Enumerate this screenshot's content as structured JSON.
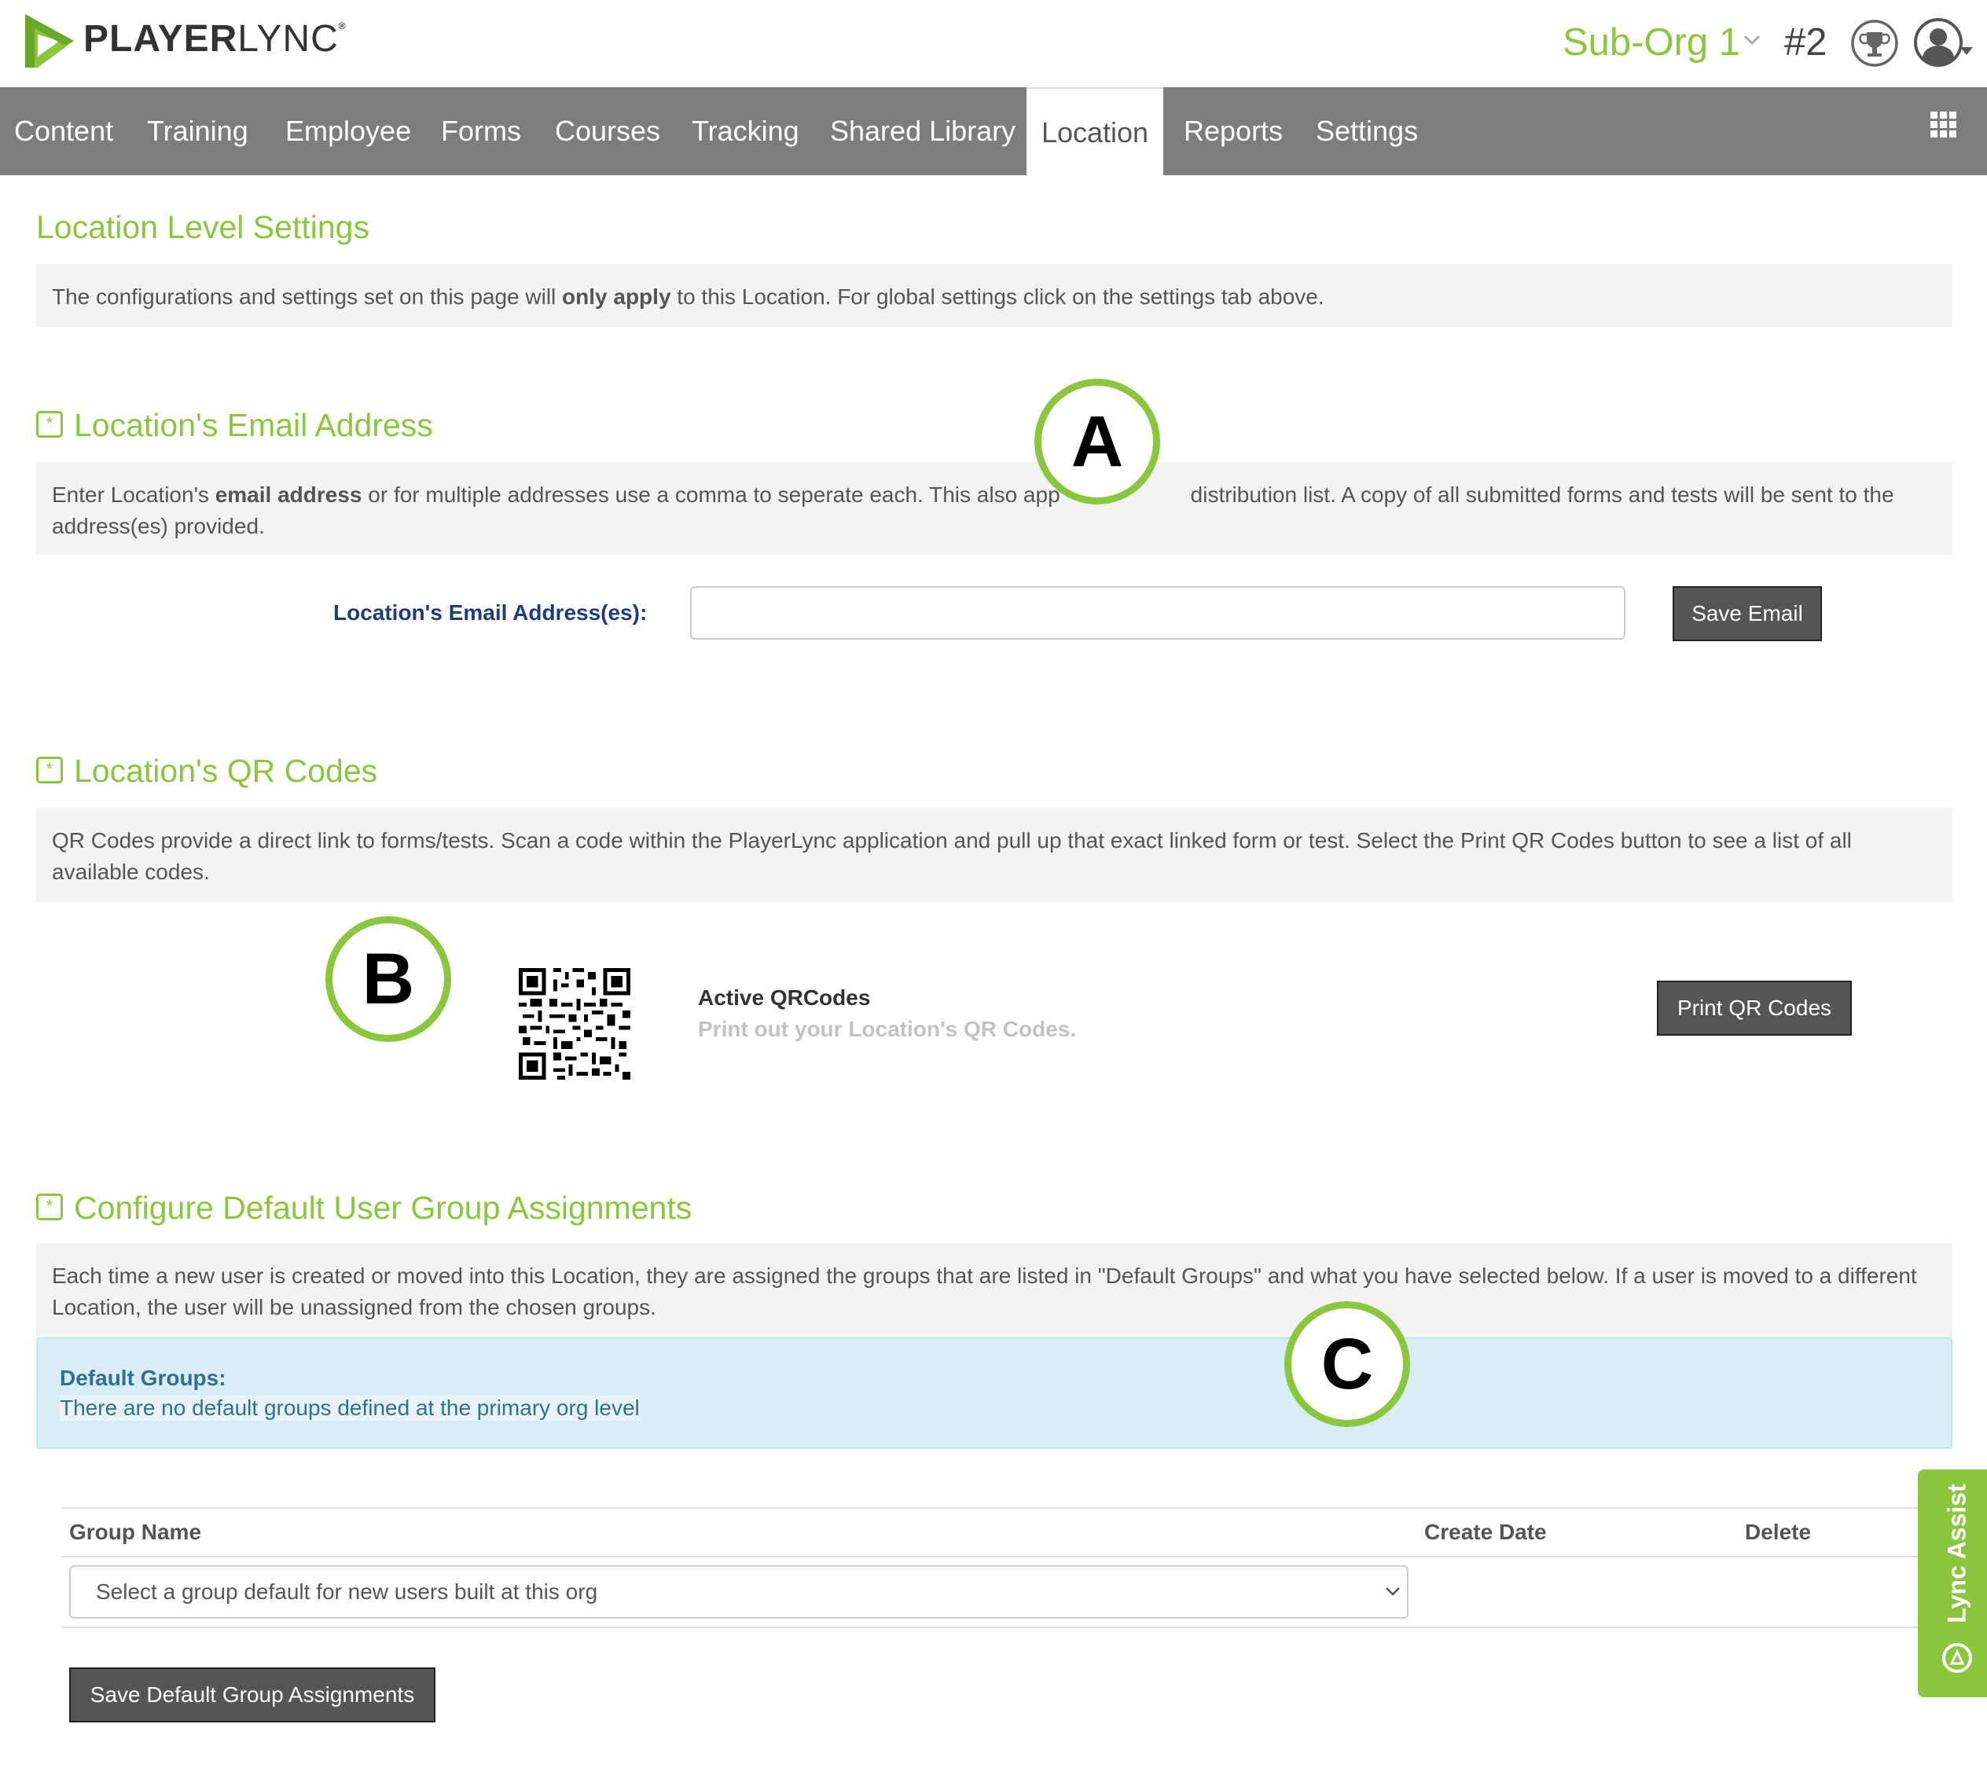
{
  "header": {
    "logo_text_bold": "PLAYER",
    "logo_text_thin": "LYNC",
    "logo_mark": "®",
    "org_name": "Sub-Org 1",
    "rank": "#2",
    "icons": [
      "playerlync-logo-icon",
      "chevron-down-icon",
      "trophy-icon",
      "user-avatar-icon",
      "caret-down-icon"
    ],
    "brand_color": "#8cc63f"
  },
  "nav": {
    "items": [
      {
        "label": "Content"
      },
      {
        "label": "Training"
      },
      {
        "label": "Employee"
      },
      {
        "label": "Forms"
      },
      {
        "label": "Courses"
      },
      {
        "label": "Tracking"
      },
      {
        "label": "Shared Library"
      },
      {
        "label": "Location",
        "active": true
      },
      {
        "label": "Reports"
      },
      {
        "label": "Settings"
      }
    ],
    "apps_icon": "grid-icon",
    "bar_color": "#7d7d7d"
  },
  "page": {
    "title": "Location Level Settings",
    "intro_pre": "The configurations and settings set on this page will ",
    "intro_bold": "only apply",
    "intro_post": " to this Location. For global settings click on the settings tab above."
  },
  "email_section": {
    "badge": "*",
    "title": "Location's Email Address",
    "desc_pre": "Enter Location's ",
    "desc_bold": "email address",
    "desc_line1_post": " or for multiple addresses use a comma to seperate each. This also app",
    "desc_line1_tail": "distribution list. A copy of all submitted forms and tests will be sent to the",
    "desc_line2": "address(es) provided.",
    "field_label": "Location's Email Address(es):",
    "field_value": "",
    "save_label": "Save Email"
  },
  "qr_section": {
    "badge": "*",
    "title": "Location's QR Codes",
    "desc_line1": "QR Codes provide a direct link to forms/tests. Scan a code within the PlayerLync application and pull up that exact linked form or test. Select the Print QR Codes button to see a list of all",
    "desc_line2": "available codes.",
    "qr_icon": "qr-code-icon",
    "active_title": "Active QRCodes",
    "active_sub": "Print out your Location's QR Codes.",
    "print_label": "Print QR Codes"
  },
  "groups_section": {
    "badge": "*",
    "title": "Configure Default User Group Assignments",
    "desc_line1": "Each time a new user is created or moved into this Location, they are assigned the groups that are listed in \"Default Groups\" and what you have selected below. If a user is moved to a different",
    "desc_line2": "Location, the user will be unassigned from the chosen groups.",
    "default_groups_heading": "Default Groups:",
    "default_groups_text": "There are no default groups defined at the primary org level",
    "table": {
      "headers": [
        "Group Name",
        "Create Date",
        "Delete"
      ]
    },
    "select_value": "Select a group default for new users built at this org",
    "save_label": "Save Default Group Assignments"
  },
  "callouts": [
    "A",
    "B",
    "C"
  ],
  "lync_assist": {
    "label": "Lync Assist",
    "icon": "lync-assist-icon"
  }
}
